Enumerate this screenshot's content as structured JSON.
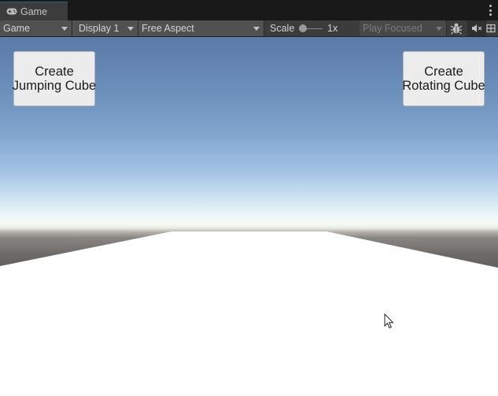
{
  "tab": {
    "title": "Game",
    "icon": "gamepad-icon"
  },
  "toolbar": {
    "view_dropdown": "Game",
    "display_dropdown": "Display 1",
    "aspect_dropdown": "Free Aspect",
    "scale_label": "Scale",
    "scale_value": "1x",
    "scale_level": 0,
    "play_mode_dropdown": "Play Focused",
    "icons": [
      "bug-icon",
      "mute-audio-icon",
      "grid-icon"
    ]
  },
  "game": {
    "buttons": {
      "jumping_line1": "Create",
      "jumping_line2": "Jumping Cube",
      "rotating_line1": "Create",
      "rotating_line2": "Rotating Cube"
    },
    "colors": {
      "sky_top": "#5a7aa7",
      "horizon": "#f7fbf7",
      "ground": "#6d6b69",
      "floor": "#ffffff"
    }
  }
}
